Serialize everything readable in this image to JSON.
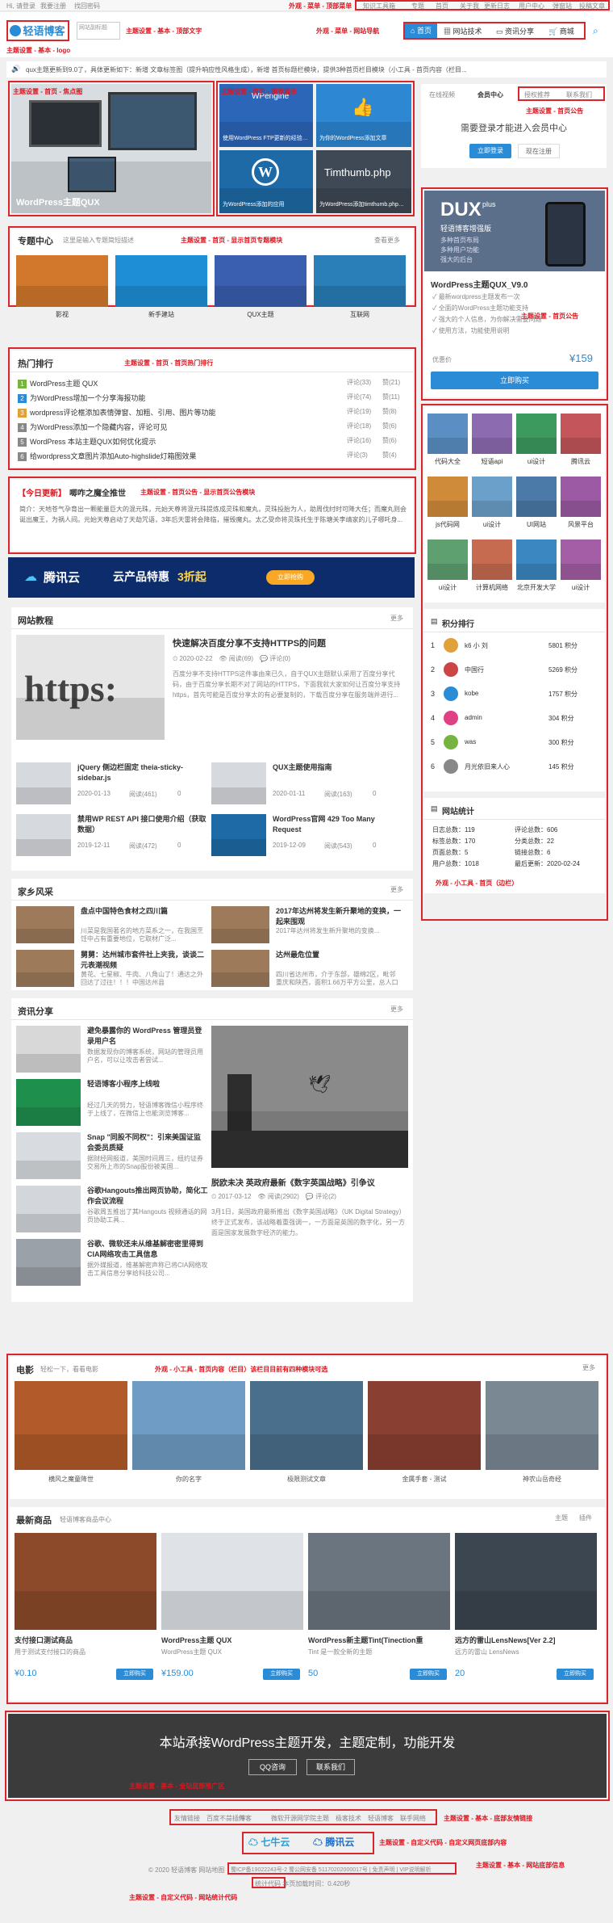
{
  "topbar": {
    "left": [
      "Hi, 请登录",
      "我要注册",
      "找回密码"
    ],
    "right": [
      "知识工具箱",
      "专题",
      "首页",
      "关于我",
      "更新日志",
      "用户中心",
      "弹窗站",
      "投稿文章"
    ],
    "left_note": "外观 - 菜单 - 顶部菜单"
  },
  "header": {
    "logo_text": "轻语博客",
    "logo_sub": "www.qingyu.com",
    "logo_note_label": "网站副标题",
    "nav": [
      "首页",
      "网站技术",
      "资讯分享",
      "商城"
    ],
    "note_bottom": "主题设置 - 基本 - logo",
    "note_right": "主题设置 - 基本 - 顶部文字",
    "nav_note": "外观 - 菜单 - 网站导航"
  },
  "notice": {
    "text": "qux主题更新到9.0了，具体更新如下：新增 文章标签图（提升响应性风格生成），新增 首页标题栏模块，提供3种首页栏目模块（小工具 - 首页内容（栏目..."
  },
  "slider": {
    "caption": "WordPress主题QUX",
    "note": "主题设置 - 首页 - 焦点图"
  },
  "promo": {
    "note": "主题设置 - 首页 - 推荐展示",
    "items": [
      {
        "title": "WPengine",
        "sub": "使用WordPress FTP更新的经验分享"
      },
      {
        "title": "为WordPress添加",
        "sub": "为你的WordPress添加文章"
      },
      {
        "title": "WordPress",
        "sub": "为WordPress添加的应用"
      },
      {
        "title": "Timthumb.php",
        "sub": "为WordPress添加timthumb.php裁剪文章缩略图"
      }
    ]
  },
  "sidebar_login": {
    "tabs": [
      "在线视频",
      "会员中心",
      "授权推荐",
      "联系我们"
    ],
    "title": "需要登录才能进入会员中心",
    "login": "立即登录",
    "register": "现在注册",
    "note": "主题设置 - 首页公告"
  },
  "product": {
    "title": "DUX",
    "plus": "plus",
    "tagline": "轻语博客增强版",
    "desc": [
      "多种首页布局",
      "多种用户功能",
      "强大的后台"
    ],
    "name": "WordPress主题QUX_V9.0",
    "features": [
      "最新wordpress主题发布一次",
      "全面的WordPress主题功能支持",
      "强大的个人信息，为你解决需要问题",
      "使用方法，功能使用说明"
    ],
    "price_label": "优惠价",
    "price": "159",
    "buy": "立即购买",
    "note": "主题设置 - 首页公告"
  },
  "icons": {
    "items": [
      "代码大全",
      "短语api",
      "ui设计",
      "腾讯云",
      "js代码网",
      "ui设计",
      "UI网站",
      "风景平台",
      "ui设计",
      "计算机网络",
      "北京开发大学",
      "ui设计"
    ]
  },
  "ranking": {
    "title": "积分排行",
    "rows": [
      {
        "n": "1",
        "name": "k6 小 刘",
        "score": "5801 积分"
      },
      {
        "n": "2",
        "name": "中国行",
        "score": "5269 积分"
      },
      {
        "n": "3",
        "name": "kobe",
        "score": "1757 积分"
      },
      {
        "n": "4",
        "name": "admin",
        "score": "304 积分"
      },
      {
        "n": "5",
        "name": "was",
        "score": "300 积分"
      },
      {
        "n": "6",
        "name": "月光依旧来人心",
        "score": "145 积分"
      }
    ]
  },
  "stats": {
    "title": "网站统计",
    "left": [
      [
        "日志总数：",
        "119"
      ],
      [
        "标签总数：",
        "170"
      ],
      [
        "页面总数：",
        "5"
      ],
      [
        "用户总数：",
        "1018"
      ]
    ],
    "right": [
      [
        "评论总数：",
        "606"
      ],
      [
        "分类总数：",
        "22"
      ],
      [
        "链接总数：",
        "6"
      ],
      [
        "最后更新：",
        "2020-02-24"
      ]
    ],
    "note": "外观 - 小工具 - 首页（边栏）"
  },
  "topics": {
    "title": "专题中心",
    "sub": "这里是输入专题简短描述",
    "more": "查看更多",
    "note": "主题设置 - 首页 - 显示首页专题模块",
    "items": [
      "影视",
      "新手建站",
      "QUX主题",
      "互联网"
    ]
  },
  "hot": {
    "title": "热门排行",
    "note": "主题设置 - 首页 - 首页热门排行",
    "rows": [
      {
        "n": "1",
        "t": "WordPress主题 QUX",
        "c": "评论(33)",
        "l": "赞(21)"
      },
      {
        "n": "2",
        "t": "为WordPress增加一个分享海报功能",
        "c": "评论(74)",
        "l": "赞(11)"
      },
      {
        "n": "3",
        "t": "wordpress评论框添加表情弹窗、加粗、引用、图片等功能",
        "c": "评论(19)",
        "l": "赞(8)"
      },
      {
        "n": "4",
        "t": "为WordPress添加一个隐藏内容，评论可见",
        "c": "评论(18)",
        "l": "赞(6)"
      },
      {
        "n": "5",
        "t": "WordPress 本站主题QUX如何优化提示",
        "c": "评论(16)",
        "l": "赞(6)"
      },
      {
        "n": "6",
        "t": "给wordpress文章图片添加Auto-highslide灯箱图效果",
        "c": "评论(3)",
        "l": "赞(4)"
      }
    ]
  },
  "daily": {
    "tag": "【今日更新】",
    "title": "唧咋之魔全推世",
    "note": "主题设置 - 首页公告 - 显示首页公告模块",
    "text": "简介：天地苍气孕育出一颗能量巨大的混元珠，元始天尊将混元珠提炼成灵珠和魔丸，灵珠投胎为人，助周伐纣时可降大任；而魔丸则会诞出魔王，为祸人间。元始天尊启动了天劫咒语，3年后天雷将会降临，摧毁魔丸。太乙受命将灵珠托生于陈塘关李靖家的儿子哪吒身..."
  },
  "banner": {
    "brand": "腾讯云",
    "text": "云产品特惠",
    "discount": "3折起",
    "cta": "立即抢购"
  },
  "tutorials": {
    "title": "网站教程",
    "more": "更多",
    "big": {
      "title": "快速解决百度分享不支持HTTPS的问题",
      "date": "2020-02-22",
      "views": "阅读(69)",
      "comments": "评论(0)",
      "excerpt": "百度分享不支持HTTPS这件事由来已久，自于QUX主题默认采用了百度分享代码，由于百度分享长期不对了网站的HTTPS，下面我就大家如何让百度分享支持https，首先可能是百度分享太的有必要复制的，下载百度分享在服务端并进行..."
    },
    "small": [
      {
        "title": "jQuery 侧边栏固定 theia-sticky-sidebar.js",
        "date": "2020-01-13",
        "views": "阅读(461)",
        "c": "0"
      },
      {
        "title": "QUX主题使用指南",
        "date": "2020-01-11",
        "views": "阅读(163)",
        "c": "0"
      },
      {
        "title": "禁用WP REST API 接口使用介绍（获取数据）",
        "date": "2019-12-11",
        "views": "阅读(472)",
        "c": "0"
      },
      {
        "title": "WordPress官网 429 Too Many Request",
        "date": "2019-12-09",
        "views": "阅读(543)",
        "c": "0"
      }
    ]
  },
  "home": {
    "title": "家乡风采",
    "more": "更多",
    "items": [
      {
        "title": "盘点中国特色食材之四川篇",
        "ex": "川菜是我国著名的地方菜系之一，在我国烹饪中占有重要地位，它取材广泛..."
      },
      {
        "title": "2017年达州将发生新升聚地的变换，一起来围观",
        "ex": "2017年达州将发生新升聚地的变换..."
      },
      {
        "title": "舅舅：达州城市套件社上夹我，谈谈二元表潮视频",
        "ex": "黄花、七星椒、牛肉、八角山了！通达之外回达了过往！！！中国达州县"
      },
      {
        "title": "达州最危位置",
        "ex": "四川省达州市，介于东部，雄绵2区，毗邻重庆和陕西，面积1.66万平方公里，总人口690"
      }
    ]
  },
  "news": {
    "title": "资讯分享",
    "more": "更多",
    "left": [
      {
        "title": "避免暴露你的 WordPress 管理员登录用户名",
        "ex": "数据发现你的博客系统，网站的管理员用户名，可以让攻击者尝试..."
      },
      {
        "title": "轻语博客小程序上线啦",
        "ex": "经过几天的努力，轻语博客微信小程序终于上线了，在微信上也能浏览博客..."
      },
      {
        "title": "Snap \"同股不同权\"：引来美国证监会委员质疑",
        "ex": "据财经网报道，美国时间周三，纽约证券交易所上市的Snap股份被美国..."
      },
      {
        "title": "谷歌Hangouts推出网页协助，简化工作会议流程",
        "ex": "谷歌周五推出了其Hangouts 视频通话的网页协助工具..."
      },
      {
        "title": "谷歌、微软还未从维基解密密里得到CIA网络攻击工具信息",
        "ex": "据外媒报道，维基解密声称已将CIA网络攻击工具信息分享给科技公司..."
      }
    ],
    "big": {
      "title": "脱欧未决 英政府最新《数字英国战略》引争议",
      "date": "2017-03-12",
      "views": "阅读(2902)",
      "comments": "评论(2)",
      "excerpt": "3月1日，英国政府最新推出《数字英国战略》（UK Digital Strategy）终于正式发布，该战略着重强调一，一方面是英国的数字化，另一方面是国家发展数字经济的能力。"
    }
  },
  "movies": {
    "title": "电影",
    "sub": "轻松一下，看看电影",
    "more": "更多",
    "note": "外观 - 小工具 - 首页内容（栏目）该栏目目前有四种模块可选",
    "items": [
      "横风之魔童降世",
      "你的名字",
      "极限测试文章",
      "金属手套 - 测试",
      "神农山岳奇经"
    ]
  },
  "shop": {
    "title": "最新商品",
    "sub": "轻语博客商品中心",
    "more": [
      "主题",
      "插件"
    ],
    "items": [
      {
        "title": "支付接口测试商品",
        "desc": "用于测试支付接口的商品",
        "price": "¥0.10"
      },
      {
        "title": "WordPress主题 QUX",
        "desc": "WordPress主题 QUX",
        "price": "¥159.00"
      },
      {
        "title": "WordPress新主题Tint(Tinection重",
        "desc": "Tint 是一款全新的主题",
        "price": "50"
      },
      {
        "title": "远方的雷山LensNews[Ver 2.2]",
        "desc": "远方的雷山 LensNews",
        "price": "20"
      }
    ],
    "buy": "立即购买"
  },
  "footer_cta": {
    "title": "本站承接WordPress主题开发，主题定制，功能开发",
    "qq": "QQ咨询",
    "contact": "联系我们",
    "note": "主题设置 - 基本 - 全站底部推广区"
  },
  "friends": {
    "links": [
      "友情链接",
      "百度不蒜插件",
      "博客",
      "微软开源网",
      "学院主题",
      "极客技术",
      "轻语博客",
      "联手网络"
    ],
    "note": "主题设置 - 基本 - 底部友情链接"
  },
  "sponsors": {
    "items": [
      "七牛云",
      "腾讯云"
    ],
    "note": "主题设置 - 自定义代码 - 自定义网页底部内容"
  },
  "footer": {
    "copy": "© 2020 轻语博客   网站地图",
    "icp": "蜀ICP备19022243号-2  蜀公网安备 51170202000017号  | 免责声明 | VIP说明解析",
    "stats": "统计代码  本页加载时间：0.420秒",
    "note_right": "主题设置 - 基本 - 网站底部信息",
    "note_bottom": "主题设置 - 自定义代码 - 网站统计代码"
  }
}
